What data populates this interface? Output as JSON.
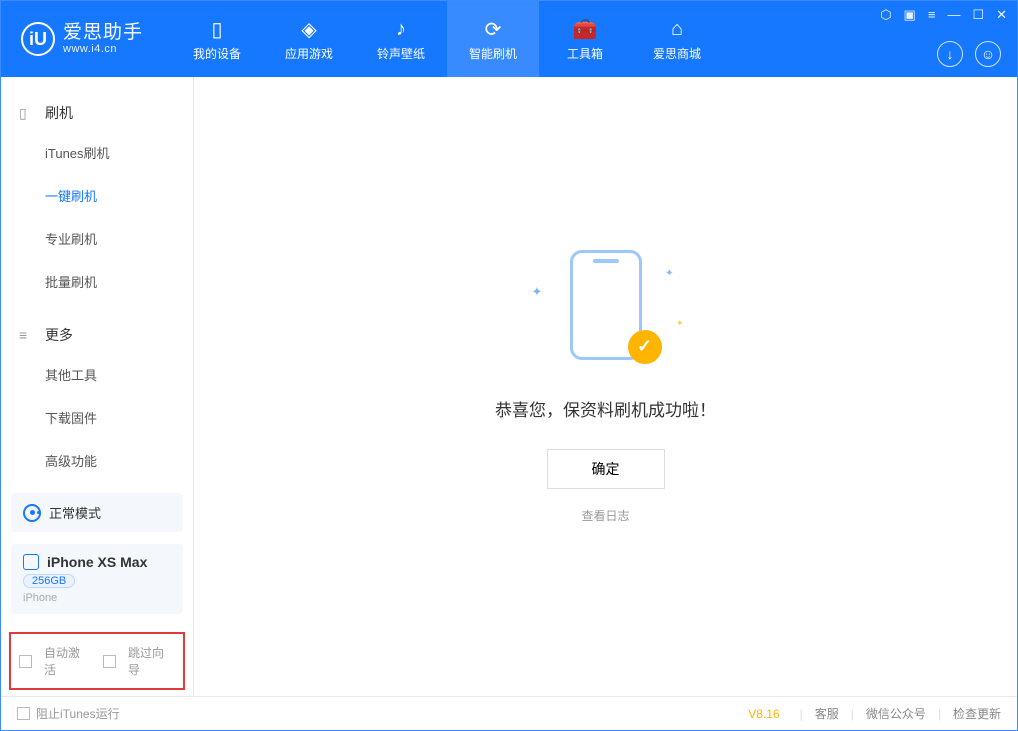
{
  "app": {
    "name": "爱思助手",
    "url": "www.i4.cn"
  },
  "nav": {
    "items": [
      {
        "label": "我的设备",
        "icon": "phone-icon"
      },
      {
        "label": "应用游戏",
        "icon": "cube-icon"
      },
      {
        "label": "铃声壁纸",
        "icon": "music-icon"
      },
      {
        "label": "智能刷机",
        "icon": "refresh-icon",
        "active": true
      },
      {
        "label": "工具箱",
        "icon": "toolbox-icon"
      },
      {
        "label": "爱思商城",
        "icon": "shop-icon"
      }
    ]
  },
  "sidebar": {
    "section1": {
      "title": "刷机",
      "items": [
        "iTunes刷机",
        "一键刷机",
        "专业刷机",
        "批量刷机"
      ],
      "active_index": 1
    },
    "section2": {
      "title": "更多",
      "items": [
        "其他工具",
        "下载固件",
        "高级功能"
      ]
    }
  },
  "device": {
    "mode": "正常模式",
    "name": "iPhone XS Max",
    "storage": "256GB",
    "type": "iPhone"
  },
  "options": {
    "auto_activate": "自动激活",
    "skip_guide": "跳过向导"
  },
  "main": {
    "success_text": "恭喜您，保资料刷机成功啦！",
    "ok_button": "确定",
    "log_link": "查看日志"
  },
  "footer": {
    "block_itunes": "阻止iTunes运行",
    "version": "V8.16",
    "links": [
      "客服",
      "微信公众号",
      "检查更新"
    ]
  }
}
